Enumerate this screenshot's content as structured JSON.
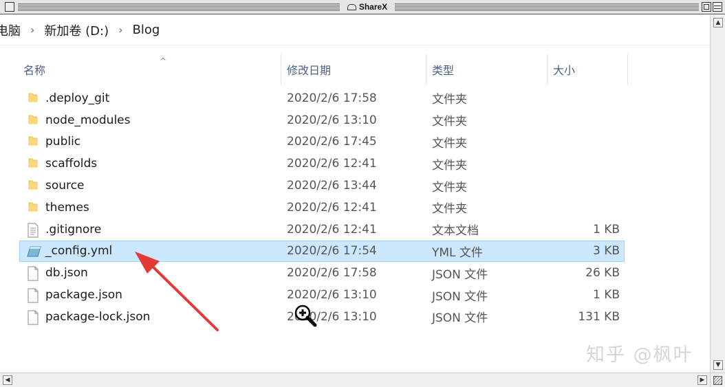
{
  "window": {
    "title": "ShareX"
  },
  "breadcrumb": {
    "items": [
      "电脑",
      "新加卷 (D:)",
      "Blog"
    ],
    "separator": "›"
  },
  "columns": {
    "name": "名称",
    "date": "修改日期",
    "type": "类型",
    "size": "大小",
    "sort_indicator": "^"
  },
  "files": [
    {
      "name": ".deploy_git",
      "date": "2020/2/6 17:58",
      "type": "文件夹",
      "size": "",
      "icon": "folder-icon"
    },
    {
      "name": "node_modules",
      "date": "2020/2/6 13:10",
      "type": "文件夹",
      "size": "",
      "icon": "folder-icon"
    },
    {
      "name": "public",
      "date": "2020/2/6 17:45",
      "type": "文件夹",
      "size": "",
      "icon": "folder-icon"
    },
    {
      "name": "scaffolds",
      "date": "2020/2/6 12:41",
      "type": "文件夹",
      "size": "",
      "icon": "folder-icon"
    },
    {
      "name": "source",
      "date": "2020/2/6 13:44",
      "type": "文件夹",
      "size": "",
      "icon": "folder-icon"
    },
    {
      "name": "themes",
      "date": "2020/2/6 12:41",
      "type": "文件夹",
      "size": "",
      "icon": "folder-icon"
    },
    {
      "name": ".gitignore",
      "date": "2020/2/6 12:41",
      "type": "文本文档",
      "size": "1 KB",
      "icon": "text-document-icon"
    },
    {
      "name": "_config.yml",
      "date": "2020/2/6 17:54",
      "type": "YML 文件",
      "size": "3 KB",
      "icon": "yml-file-icon",
      "selected": true
    },
    {
      "name": "db.json",
      "date": "2020/2/6 17:58",
      "type": "JSON 文件",
      "size": "26 KB",
      "icon": "file-icon"
    },
    {
      "name": "package.json",
      "date": "2020/2/6 13:10",
      "type": "JSON 文件",
      "size": "1 KB",
      "icon": "file-icon"
    },
    {
      "name": "package-lock.json",
      "date": "2020/2/6 13:10",
      "type": "JSON 文件",
      "size": "131 KB",
      "icon": "file-icon"
    }
  ],
  "watermark": "知乎 @枫叶",
  "colors": {
    "selection_bg": "#cce8ff",
    "selection_border": "#99d1ff",
    "folder": "#f8d775",
    "arrow": "#e53935",
    "header_text": "#4d6082"
  }
}
